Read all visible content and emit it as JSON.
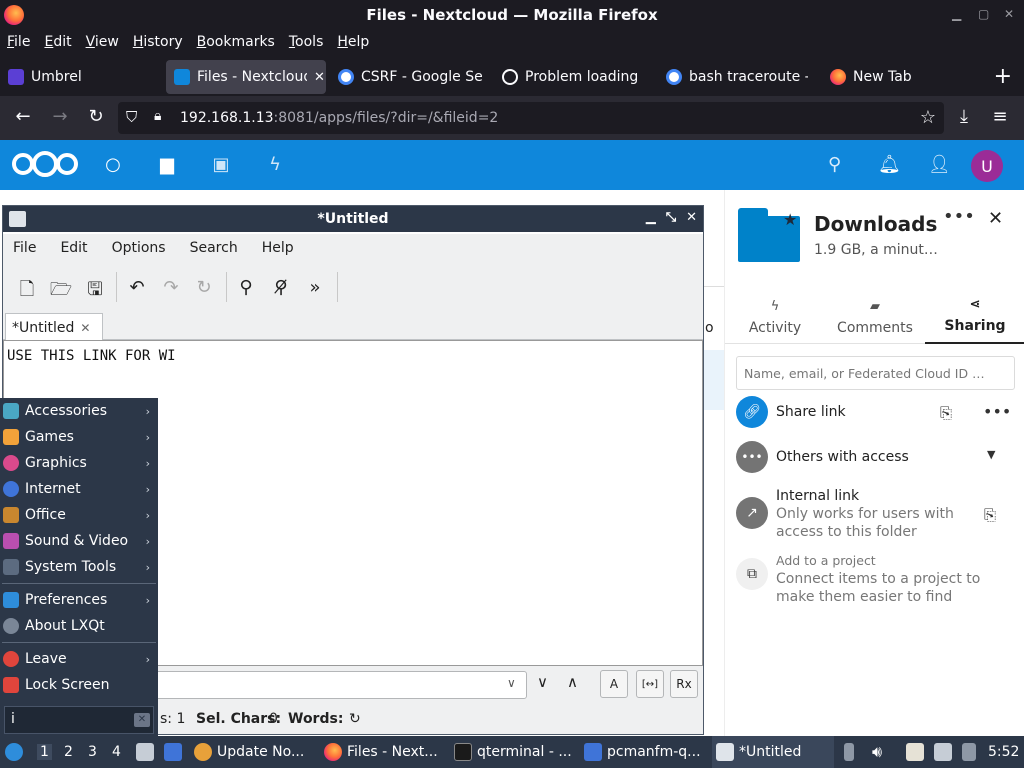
{
  "browser": {
    "window_title": "Files - Nextcloud — Mozilla Firefox",
    "menu": [
      "File",
      "Edit",
      "View",
      "History",
      "Bookmarks",
      "Tools",
      "Help"
    ],
    "tabs": [
      {
        "label": "Umbrel"
      },
      {
        "label": "Files - Nextcloud"
      },
      {
        "label": "CSRF - Google Sea"
      },
      {
        "label": "Problem loading p"
      },
      {
        "label": "bash traceroute -"
      },
      {
        "label": "New Tab"
      }
    ],
    "url_host": "192.168.1.13",
    "url_rest": ":8081/apps/files/?dir=/&fileid=2"
  },
  "nextcloud": {
    "avatar_letter": "U",
    "sidebar": {
      "title": "Downloads",
      "subtitle": "1.9 GB, a minut…",
      "tabs": [
        "Activity",
        "Comments",
        "Sharing"
      ],
      "share_placeholder": "Name, email, or Federated Cloud ID …",
      "share_link": "Share link",
      "others_access": "Others with access",
      "internal_link": "Internal link",
      "internal_desc_1": "Only works for users with",
      "internal_desc_2": "access to this folder",
      "project_label": "Add to a project",
      "project_desc_1": "Connect items to a project to",
      "project_desc_2": "make them easier to find"
    },
    "partial_text": "o"
  },
  "editor": {
    "title": "*Untitled",
    "menu": [
      "File",
      "Edit",
      "Options",
      "Search",
      "Help"
    ],
    "tab_label": "*Untitled",
    "content": "USE THIS LINK FOR WI",
    "status_partial": "s: 1",
    "sel_chars_label": "Sel. Chars:",
    "sel_chars_value": "0",
    "words_label": "Words:",
    "find_case_btn": "A",
    "find_whole_btn": "[↔]",
    "find_regex_btn": "Rx"
  },
  "launcher": {
    "items": [
      {
        "label": "Accessories",
        "color": "#4aa7c4"
      },
      {
        "label": "Games",
        "color": "#f2a23a"
      },
      {
        "label": "Graphics",
        "color": "#d94a8c"
      },
      {
        "label": "Internet",
        "color": "#3f74d8"
      },
      {
        "label": "Office",
        "color": "#c9872f"
      },
      {
        "label": "Sound & Video",
        "color": "#b94fb0"
      },
      {
        "label": "System Tools",
        "color": "#5c6b80"
      },
      {
        "label": "Preferences",
        "color": "#2e8ddb"
      },
      {
        "label": "About LXQt",
        "color": "#7a8697"
      },
      {
        "label": "Leave",
        "color": "#e0453c"
      },
      {
        "label": "Lock Screen",
        "color": "#e0453c"
      }
    ],
    "search_value": "i"
  },
  "panel": {
    "desktops": [
      "1",
      "2",
      "3",
      "4"
    ],
    "tasks": [
      {
        "label": "Update No..."
      },
      {
        "label": "Files - Next..."
      },
      {
        "label": "qterminal - ..."
      },
      {
        "label": "pcmanfm-q..."
      },
      {
        "label": "*Untitled"
      }
    ],
    "clock": "5:52"
  },
  "colors": {
    "nextcloud_blue": "#0f87db",
    "lxqt_panel": "#2c3748",
    "firefox_dark": "#1c1b22"
  }
}
